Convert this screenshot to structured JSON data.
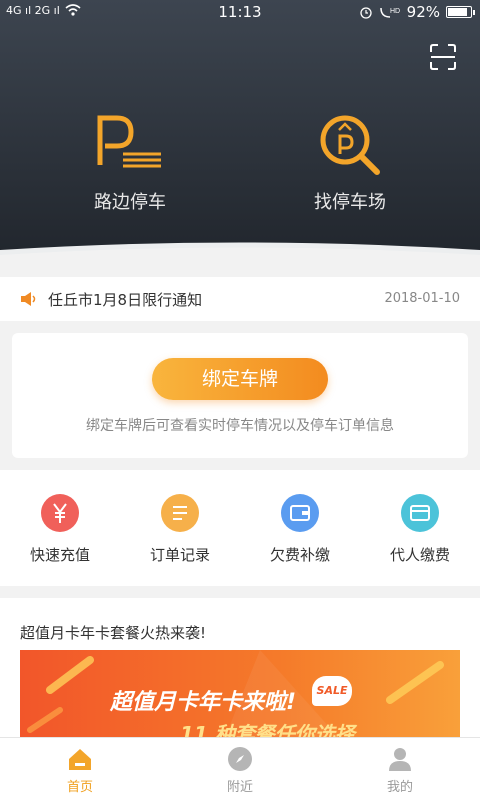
{
  "status": {
    "time": "11:13",
    "battery": "92%",
    "battery_level": 0.92,
    "left_signal": "4G ıl 2G ıl"
  },
  "header": {
    "entries": [
      {
        "label": "路边停车",
        "icon": "parking-p-icon"
      },
      {
        "label": "找停车场",
        "icon": "parking-search-icon"
      }
    ],
    "scan_icon": "scan-icon"
  },
  "notice": {
    "text": "任丘市1月8日限行通知",
    "date": "2018-01-10"
  },
  "bind": {
    "button": "绑定车牌",
    "description": "绑定车牌后可查看实时停车情况以及停车订单信息"
  },
  "quick_actions": [
    {
      "label": "快速充值",
      "icon": "yen-icon",
      "color": "#f0605a"
    },
    {
      "label": "订单记录",
      "icon": "list-icon",
      "color": "#f6b04a"
    },
    {
      "label": "欠费补缴",
      "icon": "wallet-icon",
      "color": "#5a9cf0"
    },
    {
      "label": "代人缴费",
      "icon": "card-icon",
      "color": "#4cc3d9"
    }
  ],
  "promo": {
    "title": "超值月卡年卡套餐火热来袭!",
    "banner_line1": "超值月卡年卡来啦!",
    "banner_line2": "11 种套餐任你选择",
    "sale_badge": "SALE"
  },
  "tabbar": [
    {
      "label": "首页",
      "icon": "home-icon",
      "active": true
    },
    {
      "label": "附近",
      "icon": "compass-icon",
      "active": false
    },
    {
      "label": "我的",
      "icon": "user-icon",
      "active": false
    }
  ],
  "colors": {
    "accent": "#f0a020",
    "header_dark": "#2c3138"
  }
}
